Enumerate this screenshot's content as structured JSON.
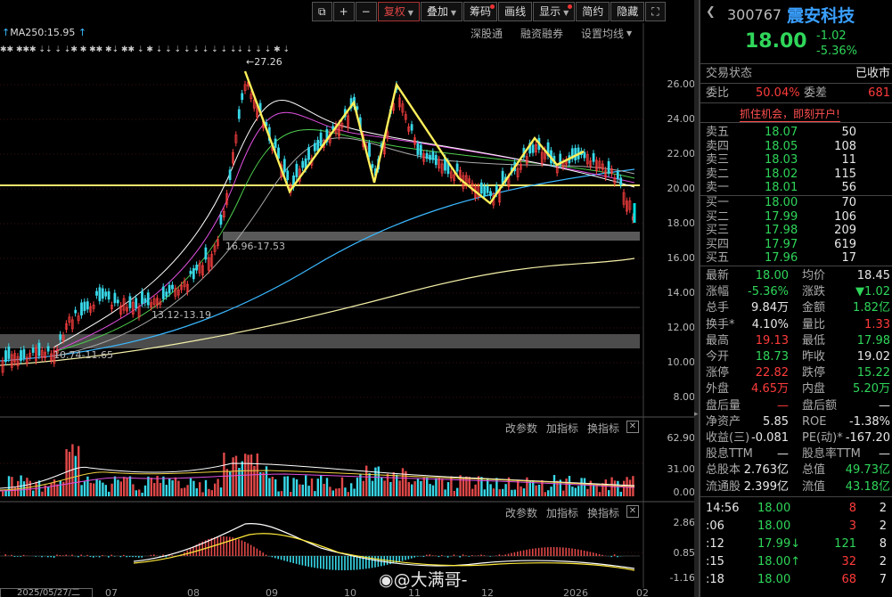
{
  "toolbar": {
    "items": [
      "复权",
      "叠加",
      "筹码",
      "画线",
      "显示",
      "简约",
      "隐藏"
    ],
    "active": "复权"
  },
  "ma_label": "MA250:15.95",
  "sub_links": [
    "深股通",
    "融资融券",
    "设置均线"
  ],
  "price_axis": [
    "26.00",
    "24.00",
    "22.00",
    "20.00",
    "18.00",
    "16.00",
    "14.00",
    "12.00",
    "10.00",
    "8.00"
  ],
  "annotations": {
    "high": "←27.26",
    "zone1": "16.96-17.53",
    "zone2": "13.12-13.19",
    "zone3": "10.74-11.65"
  },
  "volume_panel": {
    "links": [
      "改参数",
      "加指标",
      "换指标"
    ],
    "axis": [
      "62.90",
      "31.00",
      "0.00"
    ]
  },
  "macd_panel": {
    "links": [
      "改参数",
      "加指标",
      "换指标"
    ],
    "axis": [
      "2.86",
      "0.85",
      "-1.16"
    ]
  },
  "x_axis": [
    "2025/05/27/二",
    "07",
    "08",
    "09",
    "10",
    "11",
    "12",
    "2026",
    "02"
  ],
  "watermark": "@大满哥-",
  "quote": {
    "code": "300767",
    "name": "震安科技",
    "price": "18.00",
    "change": "-1.02",
    "change_pct": "-5.36%",
    "status_label": "交易状态",
    "status_value": "已收市",
    "weibi_label": "委比",
    "weibi_value": "50.04%",
    "weicha_label": "委差",
    "weicha_value": "681",
    "promo": "抓住机会，即刻开户!",
    "asks": [
      {
        "label": "卖五",
        "price": "18.07",
        "vol": "50"
      },
      {
        "label": "卖四",
        "price": "18.05",
        "vol": "108"
      },
      {
        "label": "卖三",
        "price": "18.03",
        "vol": "11"
      },
      {
        "label": "卖二",
        "price": "18.02",
        "vol": "115"
      },
      {
        "label": "卖一",
        "price": "18.01",
        "vol": "56"
      }
    ],
    "bids": [
      {
        "label": "买一",
        "price": "18.00",
        "vol": "70"
      },
      {
        "label": "买二",
        "price": "17.99",
        "vol": "106"
      },
      {
        "label": "买三",
        "price": "17.98",
        "vol": "209"
      },
      {
        "label": "买四",
        "price": "17.97",
        "vol": "619"
      },
      {
        "label": "买五",
        "price": "17.96",
        "vol": "17"
      }
    ],
    "stats": [
      {
        "l1": "最新",
        "v1": "18.00",
        "l2": "均价",
        "v2": "18.45"
      },
      {
        "l1": "涨幅",
        "v1": "-5.36%",
        "l2": "涨跌",
        "v2": "▼1.02"
      },
      {
        "l1": "总手",
        "v1": "9.84万",
        "l2": "金额",
        "v2": "1.82亿"
      },
      {
        "l1": "换手*",
        "v1": "4.10%",
        "l2": "量比",
        "v2": "1.33"
      },
      {
        "l1": "最高",
        "v1": "19.13",
        "l2": "最低",
        "v2": "17.98"
      },
      {
        "l1": "今开",
        "v1": "18.73",
        "l2": "昨收",
        "v2": "19.02"
      },
      {
        "l1": "涨停",
        "v1": "22.82",
        "l2": "跌停",
        "v2": "15.22"
      },
      {
        "l1": "外盘",
        "v1": "4.65万",
        "l2": "内盘",
        "v2": "5.20万"
      },
      {
        "l1": "盘后量",
        "v1": "—",
        "l2": "盘后额",
        "v2": "—"
      },
      {
        "l1": "净资产",
        "v1": "5.85",
        "l2": "ROE",
        "v2": "-1.38%"
      },
      {
        "l1": "收益(三)",
        "v1": "-0.081",
        "l2": "PE(动)*",
        "v2": "-167.20"
      },
      {
        "l1": "股息TTM",
        "v1": "—",
        "l2": "股息率TTM",
        "v2": "—"
      },
      {
        "l1": "总股本",
        "v1": "2.763亿",
        "l2": "总值",
        "v2": "49.73亿"
      },
      {
        "l1": "流通股",
        "v1": "2.399亿",
        "l2": "流值",
        "v2": "43.18亿"
      }
    ],
    "ticks": [
      {
        "time": "14:56",
        "price": "18.00",
        "vol": "8",
        "n": "2",
        "arrow": ""
      },
      {
        "time": ":06",
        "price": "18.00",
        "vol": "3",
        "n": "2",
        "arrow": ""
      },
      {
        "time": ":12",
        "price": "17.99",
        "vol": "121",
        "n": "8",
        "arrow": "↓"
      },
      {
        "time": ":15",
        "price": "18.00",
        "vol": "32",
        "n": "2",
        "arrow": "↑"
      },
      {
        "time": ":18",
        "price": "18.00",
        "vol": "68",
        "n": "7",
        "arrow": ""
      }
    ]
  }
}
